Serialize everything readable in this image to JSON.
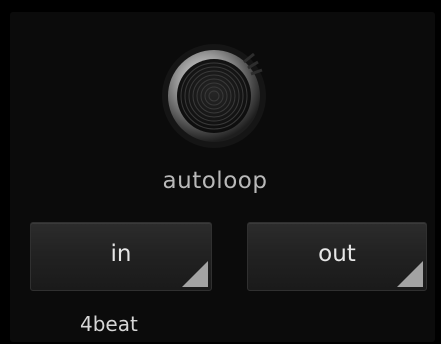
{
  "colors": {
    "background": "#000000",
    "panel": "#0b0b0b",
    "pad_surface": "#262626",
    "corner_marker": "#a3a3a3",
    "label_text": "#b9b9b9",
    "knob_ring": "#c9c9c9",
    "knob_face": "#141414"
  },
  "knob": {
    "icon": "rotary-encoder-icon",
    "label": "autoloop"
  },
  "pads": {
    "in": {
      "label": "in",
      "icon": "triangle-corner-marker"
    },
    "out": {
      "label": "out",
      "icon": "triangle-corner-marker"
    }
  },
  "loop_length": "4beat"
}
